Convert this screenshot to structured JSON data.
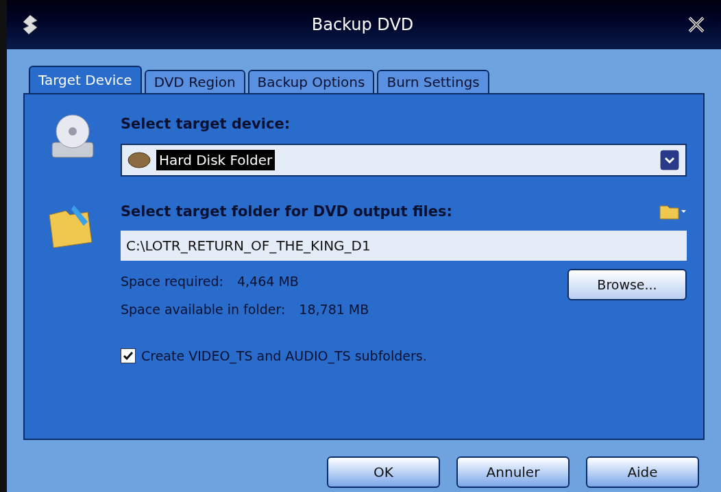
{
  "window": {
    "title": "Backup DVD"
  },
  "tabs": [
    {
      "label": "Target Device",
      "selected": true
    },
    {
      "label": "DVD Region",
      "selected": false
    },
    {
      "label": "Backup Options",
      "selected": false
    },
    {
      "label": "Burn Settings",
      "selected": false
    }
  ],
  "device": {
    "heading": "Select target device:",
    "value": "Hard Disk Folder"
  },
  "folder": {
    "heading": "Select target folder for DVD output files:",
    "value": "C:\\LOTR_RETURN_OF_THE_KING_D1"
  },
  "space": [
    {
      "label": "Space required:",
      "value": "4,464 MB"
    },
    {
      "label": "Space available in folder:",
      "value": "18,781 MB"
    }
  ],
  "browse_button": "Browse...",
  "subfolders_checkbox": {
    "label": "Create VIDEO_TS and AUDIO_TS subfolders.",
    "checked": true
  },
  "buttons": [
    "OK",
    "Annuler",
    "Aide"
  ]
}
